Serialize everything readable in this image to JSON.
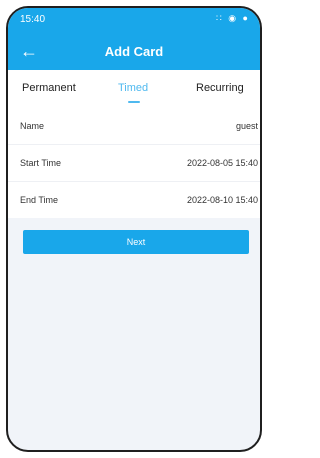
{
  "status_bar": {
    "time": "15:40",
    "icons": "∷ ◉ ●"
  },
  "header": {
    "back_icon": "←",
    "title": "Add Card"
  },
  "tabs": [
    {
      "label": "Permanent"
    },
    {
      "label": "Timed",
      "selected": true
    },
    {
      "label": "Recurring"
    }
  ],
  "form": {
    "rows": [
      {
        "label": "Name",
        "value": "guest"
      },
      {
        "label": "Start Time",
        "value": "2022-08-05 15:40"
      },
      {
        "label": "End Time",
        "value": "2022-08-10 15:40"
      }
    ]
  },
  "actions": {
    "next_label": "Next"
  },
  "colors": {
    "accent": "#19a7ea",
    "selected_tab": "#4fb9ef",
    "background": "#f1f4f9"
  }
}
